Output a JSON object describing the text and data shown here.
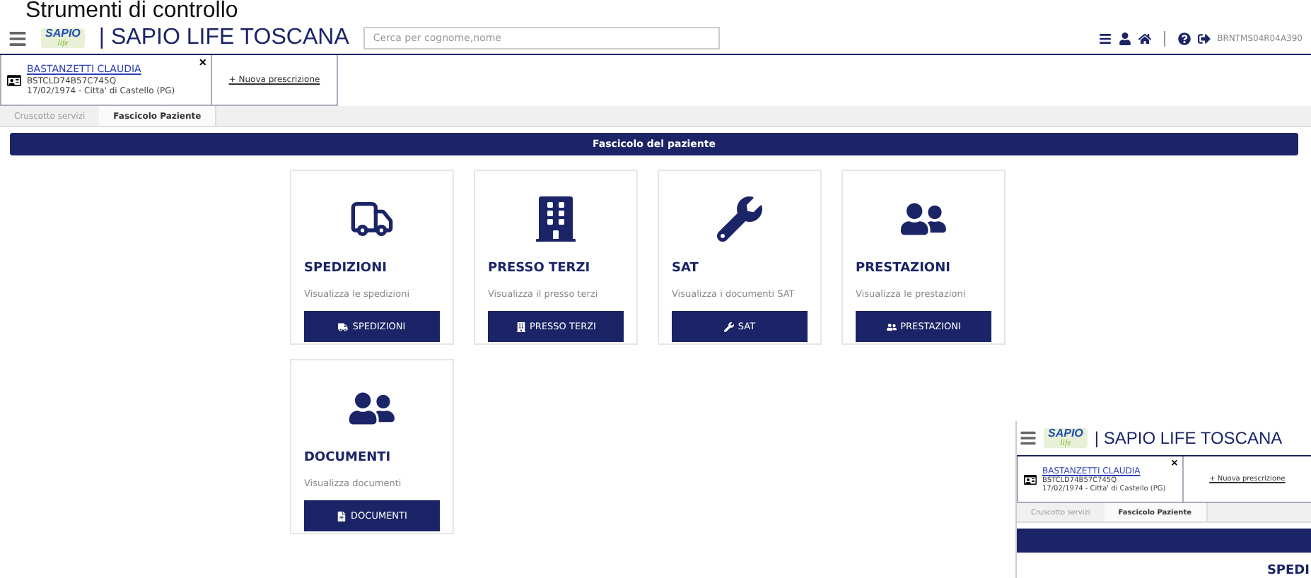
{
  "slide_title": "Strumenti di controllo",
  "header": {
    "logo": "SAPIO",
    "logo_sub": "life",
    "app_title": "| SAPIO LIFE TOSCANA",
    "search": {
      "placeholder": "Cerca per cognome,nome"
    },
    "user_code": "BRNTMS04R04A390"
  },
  "patient": {
    "name": "BASTANZETTI CLAUDIA",
    "code": "BSTCLD74B57C745Q",
    "birth": "17/02/1974 - Citta' di Castello (PG)",
    "close": "×"
  },
  "new_prescription": "+ Nuova prescrizione",
  "tabs": [
    {
      "label": "Cruscotto servizi",
      "selected": false
    },
    {
      "label": "Fascicolo Paziente",
      "selected": true
    }
  ],
  "section_title": "Fascicolo del paziente",
  "cards": [
    {
      "kind": "truck",
      "title": "SPEDIZIONI",
      "description": "Visualizza le spedizioni",
      "button": "SPEDIZIONI"
    },
    {
      "kind": "building",
      "title": "PRESSO TERZI",
      "description": "Visualizza il presso terzi",
      "button": "PRESSO TERZI"
    },
    {
      "kind": "wrench",
      "title": "SAT",
      "description": "Visualizza i documenti SAT",
      "button": "SAT"
    },
    {
      "kind": "people",
      "title": "PRESTAZIONI",
      "description": "Visualizza le prestazioni",
      "button": "PRESTAZIONI"
    },
    {
      "kind": "documents",
      "title": "DOCUMENTI",
      "description": "Visualizza documenti",
      "button": "DOCUMENTI"
    }
  ],
  "inset": {
    "logo": "SAPIO",
    "logo_sub": "life",
    "app_title": "| SAPIO LIFE TOSCANA",
    "patient": {
      "name": "BASTANZETTI CLAUDIA",
      "code": "BSTCLD74B57C745Q",
      "birth": "17/02/1974 - Citta' di Castello (PG)",
      "close": "×"
    },
    "new_prescription": "+ Nuova prescrizione",
    "tabs": [
      {
        "label": "Cruscotto servizi",
        "selected": false
      },
      {
        "label": "Fascicolo Paziente",
        "selected": true
      }
    ],
    "next_card_title": "SPEDI"
  }
}
